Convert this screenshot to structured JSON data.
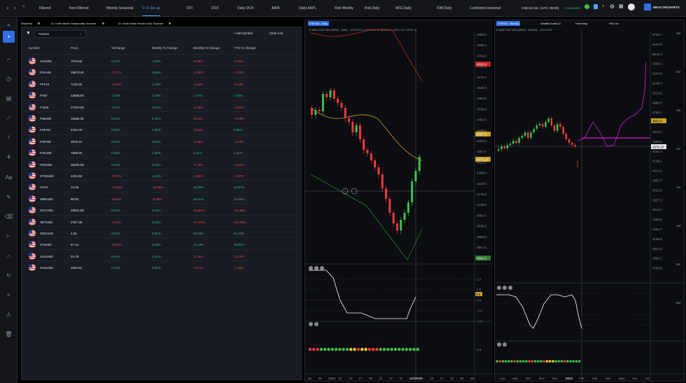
{
  "topbar": {
    "tabs": [
      "Filtered",
      "Non-Filtered",
      "Weekly Seasonal",
      "D. K Set up",
      "DFI",
      "DOX",
      "Daily DOX",
      "AAPL",
      "Daily AAPL",
      "Rob Weekly",
      "Rob Daily",
      "AFG Daily",
      "IDM Daily",
      "Combined seasonal"
    ],
    "active_tab": "D. K Set up",
    "time": "6:50:13 AM",
    "timezone": "(UTC -05:00)",
    "status": "Connected",
    "brand": "WEALTHCHARTS"
  },
  "watchlist": {
    "title": "Watchlist",
    "tab1": "Dr. Keith Wade Seasonality Scanner",
    "tab2": "Dr. Keith Wade Hedon Auto Scanner",
    "filter_value": "Futures",
    "add_symbol": "+ Add Symbol",
    "clear_list": "Clear List",
    "columns": [
      "Symbol",
      "Price",
      "%Change",
      "Weekly % Change",
      "Monthly % Change",
      "YTD % Change"
    ],
    "rows": [
      [
        "AUS200",
        "7076.60",
        "0.17%",
        "1.39%",
        "-5.95%",
        "-6.55%"
      ],
      [
        "FDAXM",
        "15673.40",
        "-0.17%",
        "1.65%",
        "-2.92%",
        "-1.33%"
      ],
      [
        "FFCHI",
        "7132.50",
        "-0.10%",
        "1.78%",
        "-2.54%",
        "-0.43%"
      ],
      [
        "FHSI",
        "23065.00",
        "1.15%",
        "1.18%",
        "1.34%",
        "1.04%"
      ],
      [
        "FJ225",
        "27310.00",
        "1.07%",
        "2.03%",
        "-3.10%",
        "-4.02%"
      ],
      [
        "FNDXM",
        "15558.30",
        "0.67%",
        "5.43%",
        "-5.41%",
        "-6.04%"
      ],
      [
        "FSPXG",
        "6764.75",
        "0.60%",
        "1.65%",
        "-3.11%",
        "0.65%"
      ],
      [
        "FSPXM",
        "4576.10",
        "0.41%",
        "3.26%",
        "-4.38%",
        "-4.13%"
      ],
      [
        "FUK100",
        "7608.50",
        "0.35%",
        "1.05%",
        "1.41%",
        "1.41%"
      ],
      [
        "FWSXM",
        "35400.00",
        "0.33%",
        "3.15%",
        "-3.73%",
        "-3.62%"
      ],
      [
        "XTIXUSD",
        "4241.60",
        "-0.05%",
        "1.42%",
        "-3.96%",
        "-1.37%"
      ],
      [
        "UVXY",
        "13.45",
        "-12.66%",
        "-11.86%",
        "10.99%",
        "13.97%"
      ],
      [
        "XBRUSD",
        "88.92",
        "-0.64%",
        "-3.39%",
        "10.61%",
        "13.80%"
      ],
      [
        "XGTUSD",
        "28921.00",
        "0.22%",
        "2.11%",
        "-16.92%",
        "-16.36%"
      ],
      [
        "XETUSD",
        "2767.28",
        "-1.11%",
        "0.12%",
        "-27.00%",
        "-27.40%"
      ],
      [
        "XNGUSD",
        "4.05",
        "2.52%",
        "5.92%",
        "32.50%",
        "31.37%"
      ],
      [
        "XTIUSD",
        "87.12",
        "-0.41%",
        "0.43%",
        "13.19%",
        "15.81%"
      ],
      [
        "XAUUSD",
        "22.79",
        "0.64%",
        "1.41%",
        "-1.16%",
        "-2.24%"
      ],
      [
        "XAUUSD",
        "1832.51",
        "0.10%",
        "0.62%",
        "-3.07%",
        "-1.43%"
      ]
    ]
  },
  "chart1": {
    "tag": "FSPXM - Daily",
    "info": "E-MINI S&P 500 (MAR) - Daily - 1/31/2022  O 4576.10  H 4615.00  L 4523.75  C 4576.10",
    "labels": [
      "4592.0",
      "4587.5",
      "4576.10",
      "4502.2"
    ],
    "yaxis": [
      "4858.0",
      "4805.4",
      "4753.0",
      "4713.6",
      "4676.0",
      "4630.0",
      "4584.6",
      "4539.0",
      "4493.6",
      "4448.0",
      "4402.6",
      "4357.0",
      "4311.6",
      "4266.0",
      "4220.6",
      "4175.0",
      "4129.6",
      "4084.0",
      "4038.6",
      "3993.0",
      "3947.6",
      "3902.0"
    ],
    "xaxis": [
      "26",
      "29",
      "2022",
      "10",
      "13",
      "17",
      "20",
      "24",
      "27",
      "31",
      "2/1/2022",
      "10",
      "14",
      "17",
      "22",
      "25",
      "28"
    ],
    "osc_scale": [
      "1.0",
      "0.5",
      "0.0",
      "-0.5",
      "-1.0"
    ],
    "osc_value": "0.5",
    "dot_value": "0.0"
  },
  "chart2": {
    "tag": "FSPXM - Weekly",
    "tab2": "WealthCharts1D",
    "tab3": "Heat Map",
    "tab4": "Hot List",
    "info": "E-MINI S&P 500 (MAR) - Weekly - 1/31/2022",
    "labels": [
      "4592.0",
      "4576.10"
    ],
    "yaxis": [
      "5765.7",
      "5640.5",
      "5515.3",
      "5390.1",
      "5264.9",
      "5139.7",
      "5014.5",
      "4889.3",
      "4764.1",
      "4638.9",
      "4513.7",
      "4388.5",
      "4263.3",
      "4138.1",
      "4012.9",
      "3887.7",
      "3762.5",
      "3637.3",
      "3512.1",
      "3386.9",
      "3261.7",
      "3136.5",
      "3011.3",
      "2886.1",
      "2760.9"
    ],
    "xaxis": [
      "Aug",
      "Sep",
      "Oct",
      "Nov",
      "Dec",
      "2022",
      "Feb",
      "Mar",
      "Apr",
      "May",
      "Jun",
      "Jul"
    ],
    "right_scale": [
      "3M",
      "2M",
      "1M",
      "4M",
      "2M",
      "1M",
      "8M",
      "6M"
    ]
  }
}
